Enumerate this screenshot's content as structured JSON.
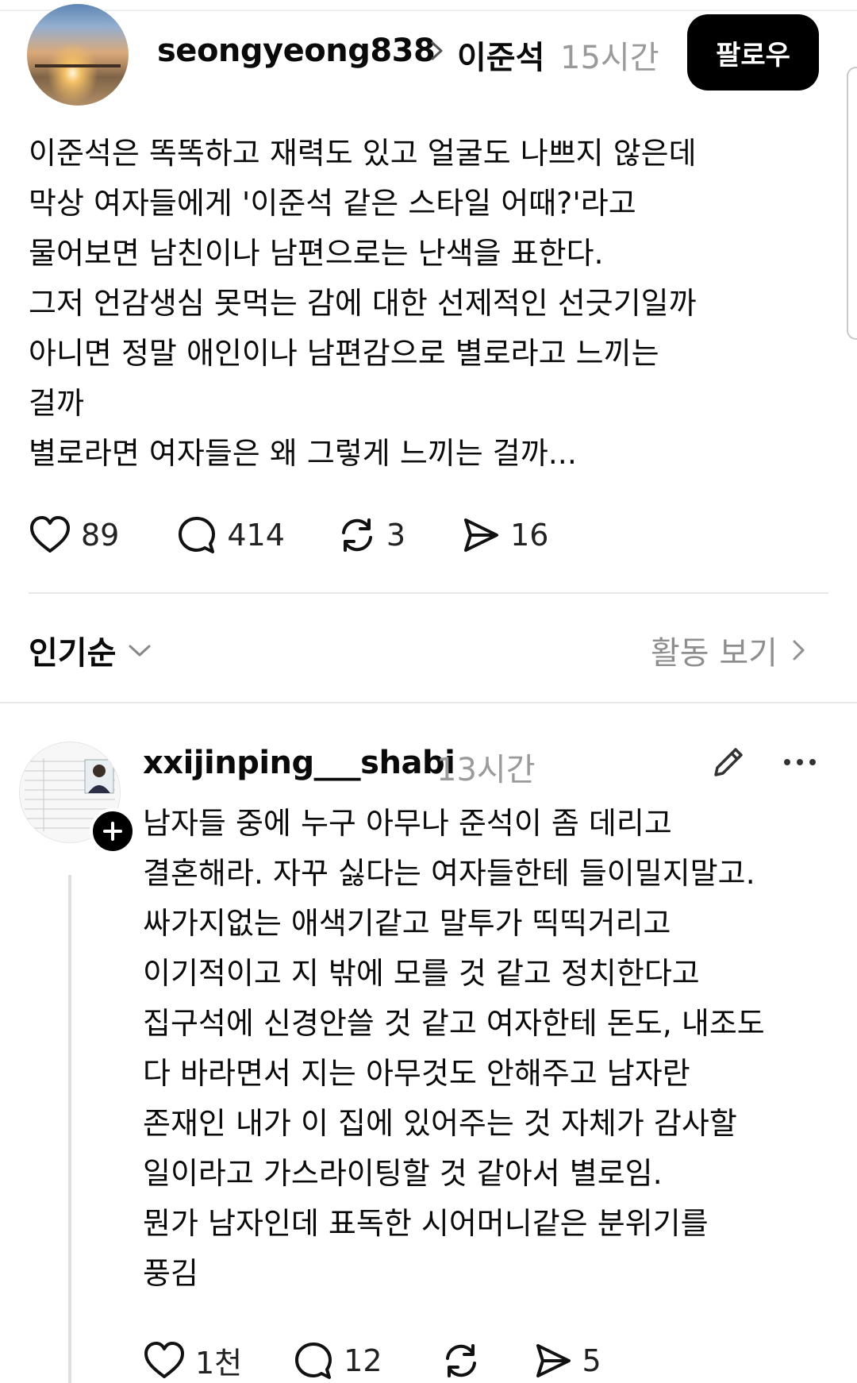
{
  "post": {
    "username": "seongyeong838",
    "topic": "이준석",
    "time": "15시간",
    "follow_label": "팔로우",
    "lines": [
      "이준석은 똑똑하고 재력도 있고 얼굴도 나쁘지 않은데",
      "막상 여자들에게 '이준석 같은 스타일 어때?'라고",
      "물어보면 남친이나 남편으로는 난색을 표한다.",
      "그저 언감생심 못먹는 감에 대한 선제적인 선긋기일까",
      "아니면 정말 애인이나 남편감으로 별로라고 느끼는",
      "걸까",
      "별로라면 여자들은 왜 그렇게 느끼는 걸까..."
    ],
    "stats": {
      "likes": "89",
      "comments": "414",
      "reposts": "3",
      "shares": "16"
    }
  },
  "sort": {
    "label": "인기순",
    "activity_label": "활동 보기"
  },
  "reply": {
    "username": "xxijinping___shabi",
    "time": "13시간",
    "lines": [
      "남자들 중에 누구 아무나 준석이 좀 데리고",
      "결혼해라. 자꾸 싫다는 여자들한테 들이밀지말고.",
      "싸가지없는 애색기같고 말투가 띡띡거리고",
      "이기적이고 지 밖에 모를 것 같고 정치한다고",
      "집구석에 신경안쓸 것 같고 여자한테 돈도, 내조도",
      "다 바라면서 지는 아무것도 안해주고 남자란",
      "존재인 내가 이 집에 있어주는 것 자체가 감사할",
      "일이라고 가스라이팅할 것 같아서 별로임.",
      "뭔가 남자인데 표독한 시어머니같은 분위기를",
      "풍김"
    ],
    "stats": {
      "likes": "1천",
      "comments": "12",
      "shares": "5"
    }
  },
  "icons": {
    "like": "heart-icon",
    "comment": "comment-bubble-icon",
    "repost": "repost-icon",
    "share": "send-icon",
    "edit": "pencil-icon",
    "more": "more-horizontal-icon",
    "follow_badge": "plus-icon"
  },
  "colors": {
    "follow_bg": "#000000",
    "muted": "#9a9a9a",
    "divider": "#e8e8e8"
  }
}
